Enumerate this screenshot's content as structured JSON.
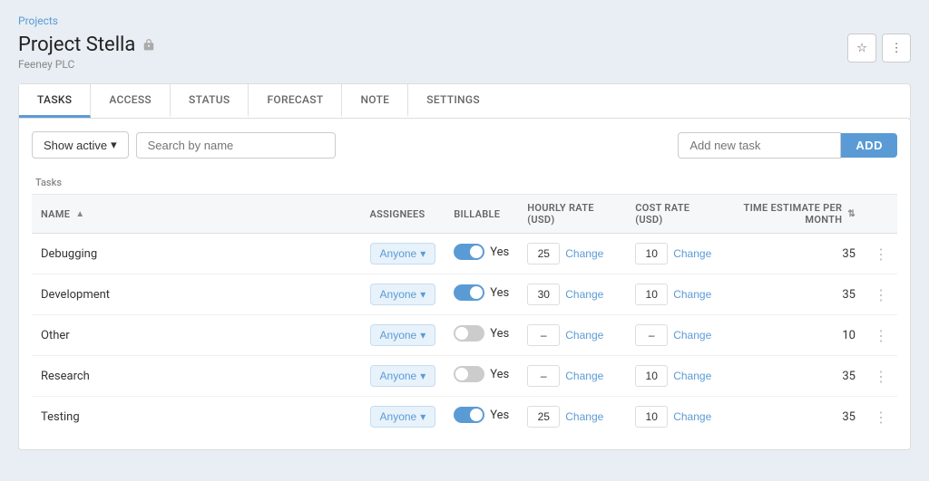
{
  "breadcrumb": {
    "label": "Projects",
    "link": "#"
  },
  "project": {
    "title": "Project Stella",
    "subtitle": "Feeney PLC",
    "lock_icon": "lock"
  },
  "header_actions": {
    "star_label": "★",
    "more_label": "⋮"
  },
  "tabs": [
    {
      "id": "tasks",
      "label": "TASKS",
      "active": true
    },
    {
      "id": "access",
      "label": "ACCESS",
      "active": false
    },
    {
      "id": "status",
      "label": "STATUS",
      "active": false
    },
    {
      "id": "forecast",
      "label": "FORECAST",
      "active": false
    },
    {
      "id": "note",
      "label": "NOTE",
      "active": false
    },
    {
      "id": "settings",
      "label": "SETTINGS",
      "active": false
    }
  ],
  "toolbar": {
    "show_active_label": "Show active",
    "search_placeholder": "Search by name",
    "add_task_placeholder": "Add new task",
    "add_button_label": "ADD"
  },
  "tasks_section": {
    "section_label": "Tasks",
    "columns": [
      {
        "key": "name",
        "label": "NAME",
        "sortable": true
      },
      {
        "key": "assignees",
        "label": "ASSIGNEES",
        "sortable": false
      },
      {
        "key": "billable",
        "label": "BILLABLE",
        "sortable": false
      },
      {
        "key": "hourly_rate",
        "label": "HOURLY RATE (USD)",
        "sortable": false
      },
      {
        "key": "cost_rate",
        "label": "COST RATE (USD)",
        "sortable": false
      },
      {
        "key": "time_estimate",
        "label": "TIME ESTIMATE PER MONTH",
        "sortable": true
      }
    ],
    "rows": [
      {
        "id": 1,
        "name": "Debugging",
        "assignee": "Anyone",
        "billable_on": true,
        "billable_label": "Yes",
        "hourly_rate": "25",
        "cost_rate": "10",
        "time_estimate": "35"
      },
      {
        "id": 2,
        "name": "Development",
        "assignee": "Anyone",
        "billable_on": true,
        "billable_label": "Yes",
        "hourly_rate": "30",
        "cost_rate": "10",
        "time_estimate": "35"
      },
      {
        "id": 3,
        "name": "Other",
        "assignee": "Anyone",
        "billable_on": false,
        "billable_label": "Yes",
        "hourly_rate": "–",
        "cost_rate": "–",
        "time_estimate": "10"
      },
      {
        "id": 4,
        "name": "Research",
        "assignee": "Anyone",
        "billable_on": false,
        "billable_label": "Yes",
        "hourly_rate": "–",
        "cost_rate": "10",
        "time_estimate": "35"
      },
      {
        "id": 5,
        "name": "Testing",
        "assignee": "Anyone",
        "billable_on": true,
        "billable_label": "Yes",
        "hourly_rate": "25",
        "cost_rate": "10",
        "time_estimate": "35"
      }
    ],
    "change_label": "Change"
  }
}
